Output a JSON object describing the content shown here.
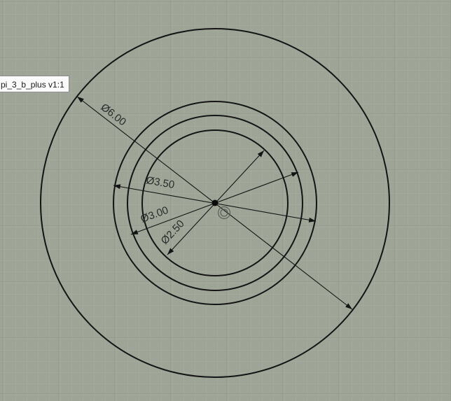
{
  "component_label": "pi_3_b_plus v1:1",
  "dimensions": [
    {
      "id": "d6",
      "label": "Ø6.00",
      "diameter": 6.0
    },
    {
      "id": "d35",
      "label": "Ø3.50",
      "diameter": 3.5
    },
    {
      "id": "d3",
      "label": "Ø3.00",
      "diameter": 3.0
    },
    {
      "id": "d25",
      "label": "Ø2.50",
      "diameter": 2.5
    }
  ],
  "colors": {
    "background": "#9ea596",
    "grid_minor": "#a9b0a1",
    "grid_major": "#8f9688",
    "sketch_line": "#141414",
    "label_bg": "#fafafa"
  }
}
